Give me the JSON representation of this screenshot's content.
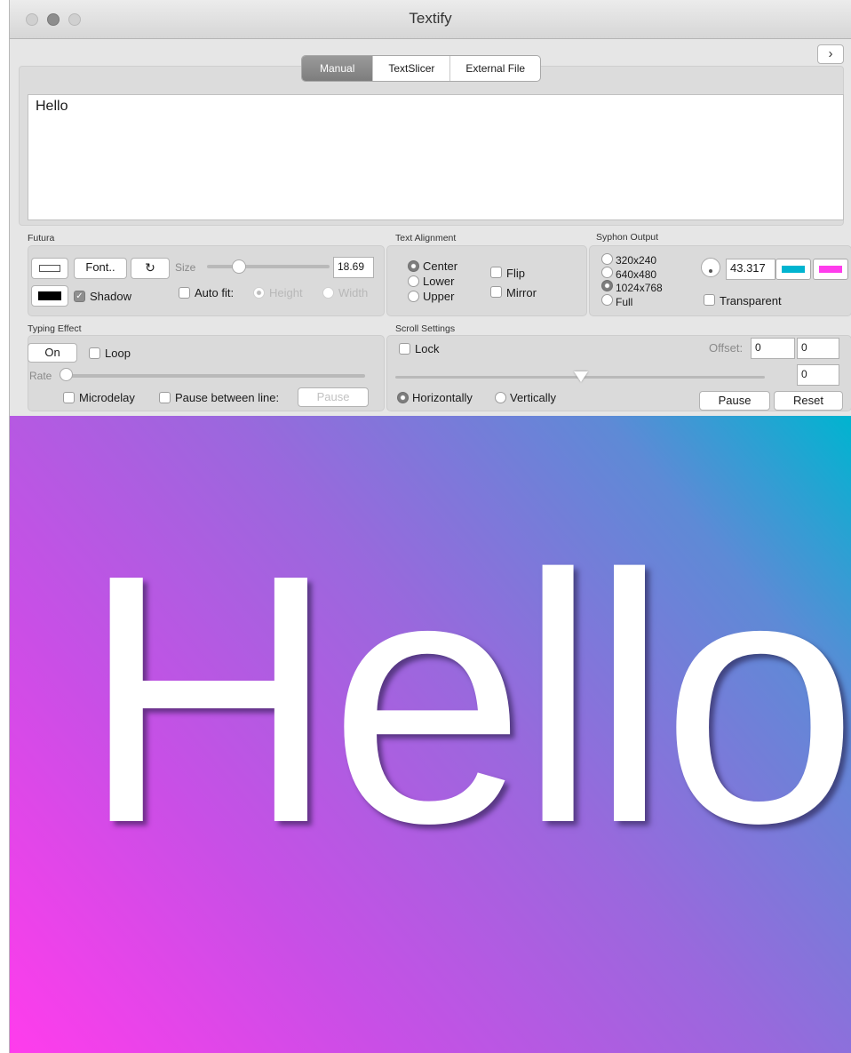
{
  "window": {
    "title": "Textify"
  },
  "tabs": [
    {
      "label": "Manual",
      "selected": true
    },
    {
      "label": "TextSlicer",
      "selected": false
    },
    {
      "label": "External File",
      "selected": false
    }
  ],
  "text_input": {
    "value": "Hello"
  },
  "font_group": {
    "label": "Futura",
    "font_button": "Font..",
    "size_label": "Size",
    "size_value": "18.69",
    "shadow_label": "Shadow",
    "shadow_checked": true,
    "autofit_label": "Auto fit:",
    "autofit_checked": false,
    "height_label": "Height",
    "width_label": "Width"
  },
  "text_alignment": {
    "label": "Text Alignment",
    "options": [
      "Center",
      "Lower",
      "Upper"
    ],
    "selected": "Center",
    "flip_label": "Flip",
    "mirror_label": "Mirror"
  },
  "syphon_output": {
    "label": "Syphon Output",
    "options": [
      "320x240",
      "640x480",
      "1024x768",
      "Full"
    ],
    "selected": "1024x768",
    "value": "43.317",
    "color1": "#00b4d0",
    "color2": "#ff3cec",
    "transparent_label": "Transparent"
  },
  "typing_effect": {
    "label": "Typing Effect",
    "on_button": "On",
    "loop_label": "Loop",
    "rate_label": "Rate",
    "microdelay_label": "Microdelay",
    "pause_between_label": "Pause between line:",
    "pause_button": "Pause"
  },
  "scroll_settings": {
    "label": "Scroll Settings",
    "lock_label": "Lock",
    "offset_label": "Offset:",
    "offset_x": "0",
    "offset_y": "0",
    "speed_value": "0",
    "horizontally_label": "Horizontally",
    "vertically_label": "Vertically",
    "pause_button": "Pause",
    "reset_button": "Reset"
  },
  "preview": {
    "text": "Hello"
  }
}
